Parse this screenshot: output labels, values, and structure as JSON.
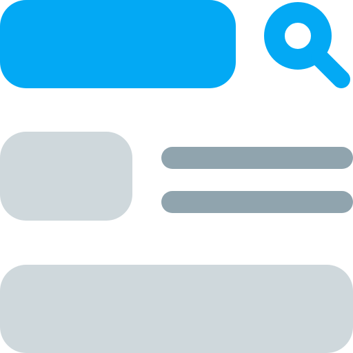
{
  "colors": {
    "accent": "#03A9F4",
    "placeholder_light": "#CFD8DC",
    "placeholder_dark": "#90A4AE",
    "background": "#FFFFFF"
  },
  "search": {
    "icon": "search-icon"
  }
}
